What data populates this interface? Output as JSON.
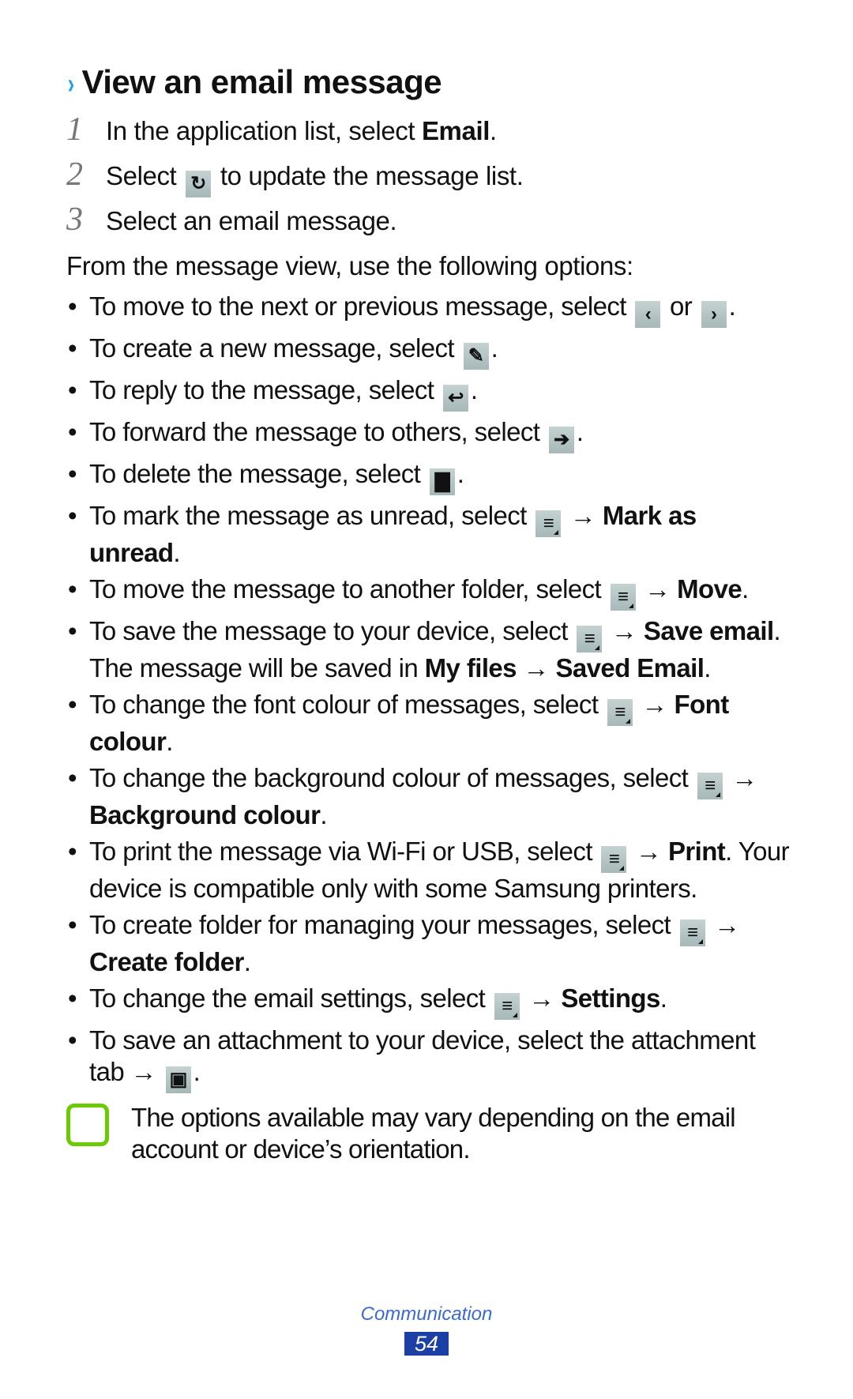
{
  "section": {
    "chevron": "›",
    "title": "View an email message"
  },
  "steps": [
    {
      "num": "1",
      "pre": "In the application list, select ",
      "bold": "Email",
      "post": "."
    },
    {
      "num": "2",
      "pre": "Select ",
      "icon": "refresh-icon",
      "post": " to update the message list."
    },
    {
      "num": "3",
      "pre": "Select an email message."
    }
  ],
  "intro": "From the message view, use the following options:",
  "bullets": {
    "b1": {
      "pre": "To move to the next or previous message, select ",
      "mid": " or ",
      "post": "."
    },
    "b2": {
      "pre": "To create a new message, select ",
      "post": "."
    },
    "b3": {
      "pre": "To reply to the message, select ",
      "post": "."
    },
    "b4": {
      "pre": "To forward the message to others, select ",
      "post": "."
    },
    "b5": {
      "pre": "To delete the message, select ",
      "post": "."
    },
    "b6": {
      "pre": "To mark the message as unread, select ",
      "arrow": " → ",
      "bold": "Mark as unread",
      "post": "."
    },
    "b7": {
      "pre": "To move the message to another folder, select ",
      "arrow": " → ",
      "bold": "Move",
      "post": "."
    },
    "b8": {
      "pre": "To save the message to your device, select ",
      "arrow": " → ",
      "bold": "Save email",
      "mid": ". The message will be saved in ",
      "bold2": "My files",
      "arrow2": " → ",
      "bold3": "Saved Email",
      "post": "."
    },
    "b9": {
      "pre": "To change the font colour of messages, select ",
      "arrow": " → ",
      "bold": "Font colour",
      "post": "."
    },
    "b10": {
      "pre": "To change the background colour of messages, select ",
      "arrow": " → ",
      "bold": "Background colour",
      "post": "."
    },
    "b11": {
      "pre": "To print the message via Wi-Fi or USB, select ",
      "arrow": " → ",
      "bold": "Print",
      "post": ". Your device is compatible only with some Samsung printers."
    },
    "b12": {
      "pre": "To create folder for managing your messages, select ",
      "arrow": " → ",
      "bold": "Create folder",
      "post": "."
    },
    "b13": {
      "pre": "To change the email settings, select ",
      "arrow": " → ",
      "bold": "Settings",
      "post": "."
    },
    "b14": {
      "pre": "To save an attachment to your device, select the attachment tab",
      "arrow": " → ",
      "post": "."
    }
  },
  "icons": {
    "prev": "‹",
    "next": "›",
    "compose": "✎",
    "reply": "↩",
    "forward": "➔",
    "delete": "▇",
    "menu": "≡",
    "save": "▣",
    "refresh": "↻"
  },
  "note": "The options available may vary depending on the email account or device’s orientation.",
  "footer": {
    "label": "Communication",
    "page": "54"
  },
  "colors": {
    "accent": "#1aa3e8",
    "note_green": "#6acb05",
    "page_badge": "#1c3fa6"
  }
}
